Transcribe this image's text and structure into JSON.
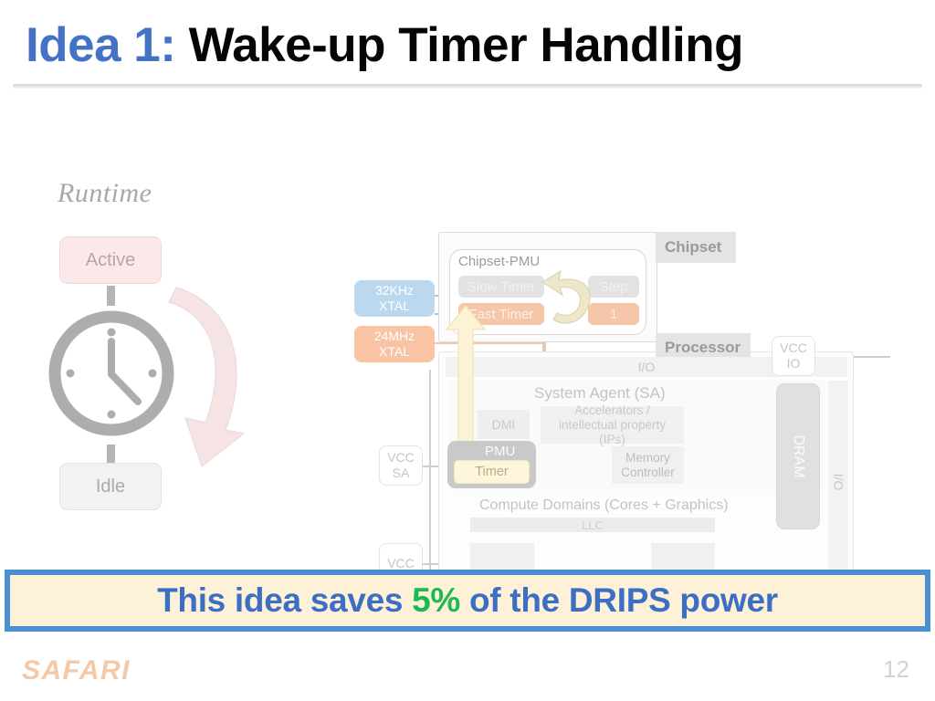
{
  "title": {
    "prefix": "Idea 1:",
    "rest": " Wake-up Timer Handling",
    "prefix_color": "#4472C4"
  },
  "runtime": {
    "label": "Runtime",
    "active_label": "Active",
    "idle_label": "Idle",
    "clock_icon": "clock-icon",
    "cycle_arrow_icon": "curved-arrow-icon"
  },
  "system": {
    "chipset_tag": "Chipset",
    "processor_tag": "Processor",
    "chipset_pmu_label": "Chipset-PMU",
    "slow_timer": "Slow Timer",
    "fast_timer": "Fast Timer",
    "step_label": "Step",
    "step_value": "1",
    "cycle_icon": "circular-arrow-icon",
    "xtal_32": "32KHz",
    "xtal_32_sub": "XTAL",
    "xtal_24": "24MHz",
    "xtal_24_sub": "XTAL",
    "io_top": "I/O",
    "io_right": "I/O",
    "system_agent": "System Agent (SA)",
    "dmi": "DMI",
    "accelerators": "Accelerators / intellectual property (IPs)",
    "memory_controller": "Memory Controller",
    "pmu": "PMU",
    "timer": "Timer",
    "compute_domains": "Compute Domains (Cores + Graphics)",
    "llc": "LLC",
    "vcc_sa": "VCC",
    "vcc_sa_sub": "SA",
    "vcc_io": "VCC",
    "vcc_io_sub": "IO",
    "vcc_bottom": "VCC",
    "dram": "DRAM",
    "wake_arrow_icon": "wake-up-arrow-icon"
  },
  "banner": {
    "text_before": "This idea saves ",
    "highlight": "5%",
    "text_after": " of the DRIPS power",
    "highlight_color": "#1DB954",
    "text_color": "#3C6FC4",
    "border_color": "#4A90D0",
    "fill_color": "#FDF2D8"
  },
  "footer": {
    "logo": "SAFARI",
    "page_number": "12"
  }
}
